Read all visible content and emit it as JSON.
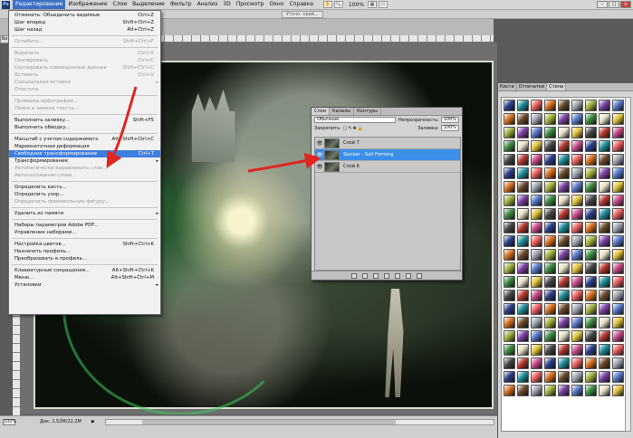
{
  "menubar": {
    "logo": "Ps",
    "items": [
      "Редактирование",
      "Изображение",
      "Слои",
      "Выделение",
      "Фильтр",
      "Анализ",
      "3D",
      "Просмотр",
      "Окно",
      "Справка"
    ],
    "zoom": "100%"
  },
  "options_bar": {
    "refine_button": "Уточн. край..."
  },
  "doc_tab": "Бе",
  "edit_menu": {
    "items": [
      {
        "label": "Отменить: Объединить видимые",
        "shortcut": "Ctrl+Z",
        "disabled": false
      },
      {
        "label": "Шаг вперед",
        "shortcut": "Shift+Ctrl+Z",
        "disabled": false
      },
      {
        "label": "Шаг назад",
        "shortcut": "Alt+Ctrl+Z",
        "disabled": false
      },
      {
        "sep": true
      },
      {
        "label": "Ослабить...",
        "shortcut": "Shift+Ctrl+F",
        "disabled": true
      },
      {
        "sep": true
      },
      {
        "label": "Вырезать",
        "shortcut": "Ctrl+X",
        "disabled": true
      },
      {
        "label": "Скопировать",
        "shortcut": "Ctrl+C",
        "disabled": true
      },
      {
        "label": "Скопировать совмещенные данные",
        "shortcut": "Shift+Ctrl+C",
        "disabled": true
      },
      {
        "label": "Вставить",
        "shortcut": "Ctrl+V",
        "disabled": true
      },
      {
        "label": "Специальная вставка",
        "shortcut": "",
        "disabled": true,
        "submenu": true
      },
      {
        "label": "Очистить",
        "shortcut": "",
        "disabled": true
      },
      {
        "sep": true
      },
      {
        "label": "Проверка орфографии...",
        "shortcut": "",
        "disabled": true
      },
      {
        "label": "Поиск и замена текста...",
        "shortcut": "",
        "disabled": true
      },
      {
        "sep": true
      },
      {
        "label": "Выполнить заливку...",
        "shortcut": "Shift+F5",
        "disabled": false
      },
      {
        "label": "Выполнить обводку...",
        "shortcut": "",
        "disabled": false
      },
      {
        "sep": true
      },
      {
        "label": "Масштаб с учетом содержимого",
        "shortcut": "Alt+Shift+Ctrl+C",
        "disabled": false
      },
      {
        "label": "Марионеточная деформация",
        "shortcut": "",
        "disabled": false
      },
      {
        "label": "Свободное трансформирование",
        "shortcut": "Ctrl+T",
        "disabled": false,
        "highlight": true
      },
      {
        "label": "Трансформирование",
        "shortcut": "",
        "disabled": false,
        "submenu": true
      },
      {
        "label": "Автоматически выравнивать слои...",
        "shortcut": "",
        "disabled": true
      },
      {
        "label": "Автоналожение слоев...",
        "shortcut": "",
        "disabled": true
      },
      {
        "sep": true
      },
      {
        "label": "Определить кисть...",
        "shortcut": "",
        "disabled": false
      },
      {
        "label": "Определить узор...",
        "shortcut": "",
        "disabled": false
      },
      {
        "label": "Определить произвольную фигуру...",
        "shortcut": "",
        "disabled": true
      },
      {
        "sep": true
      },
      {
        "label": "Удалить из памяти",
        "shortcut": "",
        "disabled": false,
        "submenu": true
      },
      {
        "sep": true
      },
      {
        "label": "Наборы параметров Adobe PDF...",
        "shortcut": "",
        "disabled": false
      },
      {
        "label": "Управление наборами...",
        "shortcut": "",
        "disabled": false
      },
      {
        "sep": true
      },
      {
        "label": "Настройка цветов...",
        "shortcut": "Shift+Ctrl+K",
        "disabled": false
      },
      {
        "label": "Назначить профиль...",
        "shortcut": "",
        "disabled": false
      },
      {
        "label": "Преобразовать в профиль...",
        "shortcut": "",
        "disabled": false
      },
      {
        "sep": true
      },
      {
        "label": "Клавиатурные сокращения...",
        "shortcut": "Alt+Shift+Ctrl+K",
        "disabled": false
      },
      {
        "label": "Меню...",
        "shortcut": "Alt+Shift+Ctrl+M",
        "disabled": false
      },
      {
        "label": "Установки",
        "shortcut": "",
        "disabled": false,
        "submenu": true
      }
    ]
  },
  "layers_panel": {
    "tabs": [
      "Слои",
      "Каналы",
      "Контуры"
    ],
    "blend_mode": "Обычные",
    "opacity_label": "Непрозрачность:",
    "opacity_value": "100%",
    "lock_label": "Закрепить:",
    "fill_label": "Заливка:",
    "fill_value": "100%",
    "layers": [
      {
        "name": "Слой 7",
        "selected": false
      },
      {
        "name": "Stocker - Suit Forming",
        "selected": true
      },
      {
        "name": "Слой 6",
        "selected": false
      }
    ]
  },
  "styles_panel": {
    "tabs": [
      "Кисти",
      "Отпечатки",
      "Стили"
    ],
    "active_tab": "Стили"
  },
  "status_bar": {
    "zoom": "100%",
    "doc_info": "Док: 2,52M/22,2M"
  },
  "colors": {
    "highlight": "#3d7ee0",
    "arrow": "#e0261f",
    "selected_layer": "#3d8ee8"
  }
}
